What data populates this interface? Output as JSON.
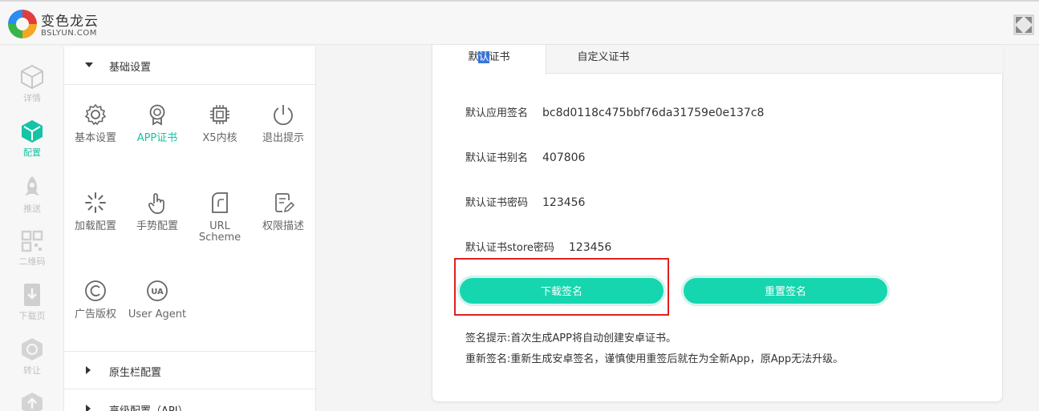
{
  "header": {
    "brand_cn": "变色龙云",
    "brand_en": "BSLYUN.COM"
  },
  "rail": [
    {
      "label": "详情",
      "icon": "cube-outline-icon"
    },
    {
      "label": "配置",
      "icon": "cube-icon",
      "active": true
    },
    {
      "label": "推送",
      "icon": "rocket-icon"
    },
    {
      "label": "二维码",
      "icon": "qr-code-icon"
    },
    {
      "label": "下载页",
      "icon": "download-page-icon"
    },
    {
      "label": "转让",
      "icon": "transfer-icon"
    }
  ],
  "menu": {
    "section_basic": "基础设置",
    "section_native": "原生栏配置",
    "section_advanced": "高级配置（API）",
    "items": [
      {
        "label": "基本设置",
        "icon": "gear-icon"
      },
      {
        "label": "APP证书",
        "icon": "certificate-icon",
        "active": true
      },
      {
        "label": "X5内核",
        "icon": "chip-icon"
      },
      {
        "label": "退出提示",
        "icon": "power-icon"
      },
      {
        "label": "加载配置",
        "icon": "loading-icon"
      },
      {
        "label": "手势配置",
        "icon": "hand-pointer-icon"
      },
      {
        "label": "URL",
        "label2": "Scheme",
        "icon": "url-scheme-icon"
      },
      {
        "label": "权限描述",
        "icon": "edit-document-icon"
      },
      {
        "label": "广告版权",
        "icon": "copyright-icon"
      },
      {
        "label": "User Agent",
        "icon": "user-agent-icon"
      }
    ]
  },
  "tabs": {
    "default_cert_pre": "默",
    "default_cert_hl": "认",
    "default_cert_post": "证书",
    "custom_cert": "自定义证书"
  },
  "cert": {
    "sign_label": "默认应用签名",
    "sign_value": "bc8d0118c475bbf76da31759e0e137c8",
    "alias_label": "默认证书别名",
    "alias_value": "407806",
    "password_label": "默认证书密码",
    "password_value": "123456",
    "store_password_label": "默认证书store密码",
    "store_password_value": "123456"
  },
  "buttons": {
    "download": "下载签名",
    "reset": "重置签名"
  },
  "notes": {
    "tip": "签名提示:首次生成APP将自动创建安卓证书。",
    "resign": "重新签名:重新生成安卓签名，谨慎使用重签后就在为全新App，原App无法升级。"
  },
  "colors": {
    "accent": "#16d6b0",
    "highlight_border": "#e02020"
  }
}
